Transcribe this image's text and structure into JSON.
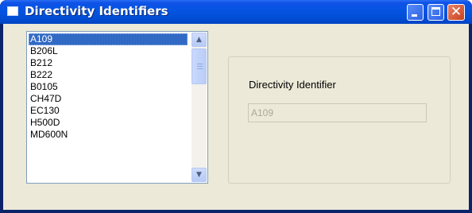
{
  "window": {
    "title": "Directivity Identifiers"
  },
  "list": {
    "items": [
      "A109",
      "B206L",
      "B212",
      "B222",
      "B0105",
      "CH47D",
      "EC130",
      "H500D",
      "MD600N"
    ],
    "selected": "A109"
  },
  "form": {
    "label": "Directivity Identifier",
    "value": "A109"
  },
  "colors": {
    "titlebar": "#0554e3",
    "client_bg": "#ece9d8",
    "selection": "#316ac5",
    "close_button": "#c8411c"
  }
}
